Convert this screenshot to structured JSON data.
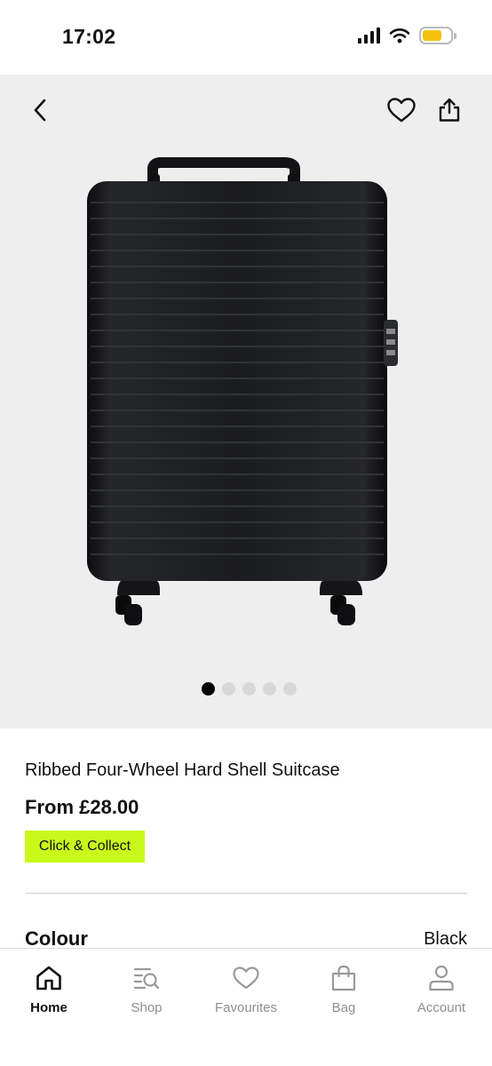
{
  "status_bar": {
    "time": "17:02",
    "icons": [
      "signal-icon",
      "wifi-icon",
      "battery-icon"
    ],
    "battery_color": "#f4c20d"
  },
  "hero": {
    "background": "#eeeeee",
    "actions": [
      "back-icon",
      "heart-icon",
      "share-icon"
    ],
    "image": "black-ribbed-suitcase",
    "carousel": {
      "count": 5,
      "active_index": 0
    }
  },
  "product": {
    "name": "Ribbed Four-Wheel Hard Shell Suitcase",
    "price": "From £28.00",
    "badge": "Click & Collect",
    "badge_color": "#c9f91a",
    "colour_label": "Colour",
    "colour_value": "Black"
  },
  "tab_bar": {
    "tabs": [
      {
        "label": "Home",
        "icon": "home-icon",
        "active": true
      },
      {
        "label": "Shop",
        "icon": "search-list-icon",
        "active": false
      },
      {
        "label": "Favourites",
        "icon": "heart-icon",
        "active": false
      },
      {
        "label": "Bag",
        "icon": "bag-icon",
        "active": false
      },
      {
        "label": "Account",
        "icon": "person-icon",
        "active": false
      }
    ]
  }
}
